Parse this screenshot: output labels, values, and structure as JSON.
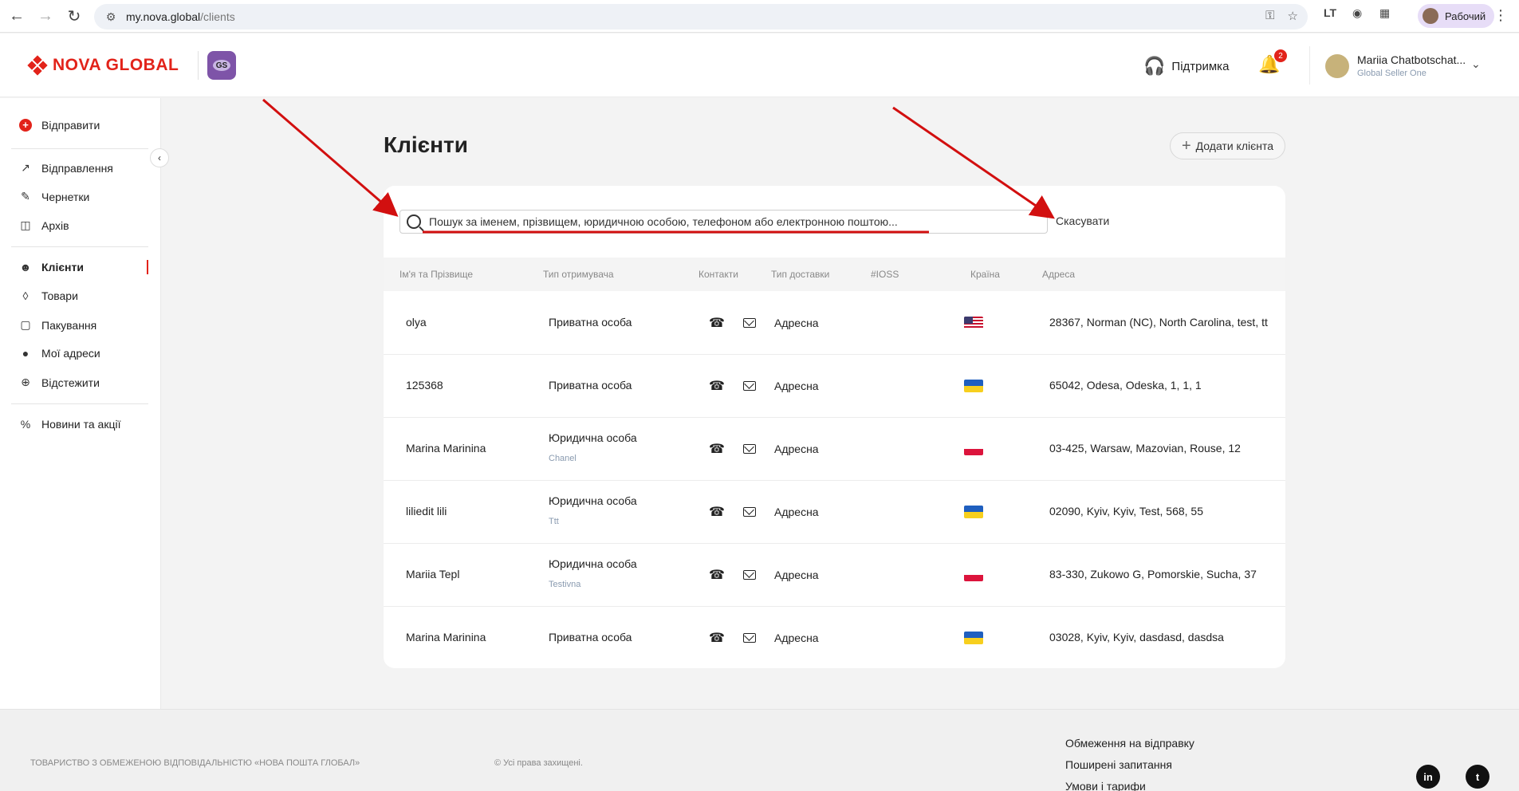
{
  "browser": {
    "url_host": "my.nova.global",
    "url_path": "/clients",
    "profile_label": "Рабочий"
  },
  "header": {
    "logo_text": "NOVA GLOBAL",
    "gs_badge": "GS",
    "support_label": "Підтримка",
    "notifications_count": "2",
    "user_name": "Mariia Chatbotschat...",
    "user_company": "Global Seller One"
  },
  "sidebar": {
    "send_label": "Відправити",
    "items": [
      {
        "label": "Відправлення",
        "icon": "arrow-up-right-icon"
      },
      {
        "label": "Чернетки",
        "icon": "edit-icon"
      },
      {
        "label": "Архів",
        "icon": "archive-icon"
      },
      {
        "label": "Клієнти",
        "icon": "users-icon"
      },
      {
        "label": "Товари",
        "icon": "tag-icon"
      },
      {
        "label": "Пакування",
        "icon": "box-icon"
      },
      {
        "label": "Мої адреси",
        "icon": "location-icon"
      },
      {
        "label": "Відстежити",
        "icon": "crosshair-icon"
      },
      {
        "label": "Новини та акції",
        "icon": "percent-icon"
      }
    ]
  },
  "main": {
    "title": "Клієнти",
    "add_client_label": "Додати клієнта",
    "search_placeholder": "Пошук за іменем, прізвищем, юридичною особою, телефоном або електронною поштою...",
    "cancel_label": "Скасувати",
    "columns": [
      "Ім'я та Прізвище",
      "Тип отримувача",
      "Контакти",
      "Тип доставки",
      "#IOSS",
      "Країна",
      "Адреса"
    ],
    "rows": [
      {
        "name": "olya",
        "type": "Приватна особа",
        "company": "",
        "delivery": "Адресна",
        "country": "us",
        "address": "28367, Norman (NC), North Carolina, test, tt"
      },
      {
        "name": "125368",
        "type": "Приватна особа",
        "company": "",
        "delivery": "Адресна",
        "country": "ua",
        "address": "65042, Odesa, Odeska, 1, 1, 1"
      },
      {
        "name": "Marina Marinina",
        "type": "Юридична особа",
        "company": "Chanel",
        "delivery": "Адресна",
        "country": "pl",
        "address": "03-425, Warsaw, Mazovian, Rouse, 12"
      },
      {
        "name": "liliedit lili",
        "type": "Юридична особа",
        "company": "Ttt",
        "delivery": "Адресна",
        "country": "ua",
        "address": "02090, Kyiv, Kyiv, Test, 568, 55"
      },
      {
        "name": "Mariia Tepl",
        "type": "Юридична особа",
        "company": "Testivna",
        "delivery": "Адресна",
        "country": "pl",
        "address": "83-330, Zukowo G, Pomorskie, Sucha, 37"
      },
      {
        "name": "Marina Marinina",
        "type": "Приватна особа",
        "company": "",
        "delivery": "Адресна",
        "country": "ua",
        "address": "03028, Kyiv, Kyiv, dasdasd, dasdsa"
      }
    ]
  },
  "footer": {
    "company": "ТОВАРИСТВО З ОБМЕЖЕНОЮ ВІДПОВІДАЛЬНІСТЮ «НОВА ПОШТА ГЛОБАЛ»",
    "copyright": "© Усі права захищені.",
    "links": [
      "Обмеження на відправку",
      "Поширені запитання",
      "Умови і тарифи"
    ],
    "social": [
      "in",
      "t"
    ]
  },
  "colors": {
    "brand_red": "#e2231a",
    "gs_purple": "#7e54a8",
    "annotation_red": "#d20f0f"
  }
}
